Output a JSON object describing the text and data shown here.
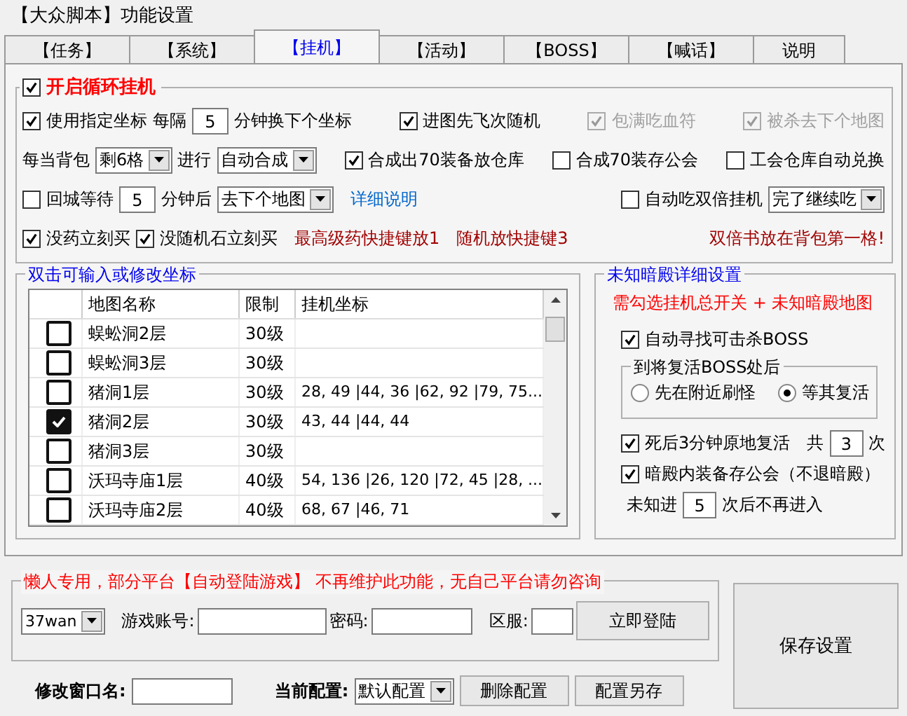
{
  "window": {
    "title": "【大众脚本】功能设置"
  },
  "tabs": [
    {
      "label": "【任务】",
      "selected": false
    },
    {
      "label": "【系统】",
      "selected": false
    },
    {
      "label": "【挂机】",
      "selected": true
    },
    {
      "label": "【活动】",
      "selected": false
    },
    {
      "label": "【BOSS】",
      "selected": false
    },
    {
      "label": "【喊话】",
      "selected": false
    },
    {
      "label": "说明",
      "selected": false
    }
  ],
  "loop_group": {
    "label": "开启循环挂机",
    "checked": true,
    "rows": [
      [
        [
          {
            "kind": "checkbox",
            "label": "使用指定坐标",
            "checked": true,
            "disabled": false
          },
          {
            "kind": "label",
            "text": "每隔"
          },
          {
            "kind": "input",
            "value": "5"
          },
          {
            "kind": "label",
            "text": "分钟换下个坐标"
          }
        ],
        [
          {
            "kind": "checkbox",
            "label": "进图先飞次随机",
            "checked": true,
            "disabled": false
          }
        ],
        [
          {
            "kind": "checkbox",
            "label": "包满吃血符",
            "checked": true,
            "disabled": true
          }
        ],
        [
          {
            "kind": "checkbox",
            "label": "被杀去下个地图",
            "checked": true,
            "disabled": true
          }
        ]
      ],
      [
        [
          {
            "kind": "label",
            "text": "每当背包"
          },
          {
            "kind": "select",
            "value": "剩6格"
          },
          {
            "kind": "label",
            "text": "进行"
          },
          {
            "kind": "select",
            "value": "自动合成"
          }
        ],
        [
          {
            "kind": "checkbox",
            "label": "合成出70装备放仓库",
            "checked": true,
            "disabled": false
          }
        ],
        [
          {
            "kind": "checkbox",
            "label": "合成70装存公会",
            "checked": false,
            "disabled": false
          }
        ],
        [
          {
            "kind": "checkbox",
            "label": "工会仓库自动兑换",
            "checked": false,
            "disabled": false
          }
        ]
      ],
      [
        [
          {
            "kind": "checkbox",
            "label": "回城等待",
            "checked": false,
            "disabled": false
          },
          {
            "kind": "input",
            "value": "5"
          },
          {
            "kind": "label",
            "text": "分钟后"
          },
          {
            "kind": "select",
            "value": "去下个地图"
          },
          {
            "kind": "link",
            "text": "详细说明"
          }
        ],
        [
          {
            "kind": "checkbox",
            "label": "自动吃双倍挂机",
            "checked": false,
            "disabled": false
          },
          {
            "kind": "select",
            "value": "完了继续吃"
          }
        ]
      ],
      [
        [
          {
            "kind": "checkbox",
            "label": "没药立刻买",
            "checked": true,
            "disabled": false
          },
          {
            "kind": "checkbox",
            "label": "没随机石立刻买",
            "checked": true,
            "disabled": false
          },
          {
            "kind": "note",
            "text": "最高级药快捷键放1"
          },
          {
            "kind": "note",
            "text": "随机放快捷键3"
          }
        ],
        [
          {
            "kind": "note",
            "text": "双倍书放在背包第一格!"
          }
        ]
      ]
    ]
  },
  "map_group": {
    "title": "双击可输入或修改坐标",
    "columns": [
      "地图名称",
      "限制",
      "挂机坐标"
    ],
    "rows": [
      {
        "checked": false,
        "name": "蜈蚣洞2层",
        "level": "30级",
        "coords": ""
      },
      {
        "checked": false,
        "name": "蜈蚣洞3层",
        "level": "30级",
        "coords": ""
      },
      {
        "checked": false,
        "name": "猪洞1层",
        "level": "30级",
        "coords": "28, 49 |44, 36 |62, 92 |79, 75..."
      },
      {
        "checked": true,
        "name": "猪洞2层",
        "level": "30级",
        "coords": "43, 44 |44, 44"
      },
      {
        "checked": false,
        "name": "猪洞3层",
        "level": "30级",
        "coords": ""
      },
      {
        "checked": false,
        "name": "沃玛寺庙1层",
        "level": "40级",
        "coords": "54, 136 |26, 120 |72, 45 |28, ..."
      },
      {
        "checked": false,
        "name": "沃玛寺庙2层",
        "level": "40级",
        "coords": "68, 67 |46, 71"
      }
    ]
  },
  "dark_group": {
    "title": "未知暗殿详细设置",
    "warning": "需勾选挂机总开关 + 未知暗殿地图",
    "auto_find": {
      "label": "自动寻找可击杀BOSS",
      "checked": true
    },
    "revive_group": {
      "title": "到将复活BOSS处后",
      "options": [
        {
          "label": "先在附近刷怪",
          "selected": false
        },
        {
          "label": "等其复活",
          "selected": true
        }
      ]
    },
    "revive": {
      "label": "死后3分钟原地复活",
      "checked": true,
      "prefix": "共",
      "value": "3",
      "suffix": "次"
    },
    "store": {
      "label": "暗殿内装备存公会（不退暗殿）",
      "checked": true
    },
    "limit": {
      "prefix": "未知进",
      "value": "5",
      "suffix": "次后不再进入"
    }
  },
  "login_group": {
    "title": "懒人专用，部分平台【自动登陆游戏】 不再维护此功能，无自己平台请勿咨询",
    "platform": "37wan",
    "account_label": "游戏账号:",
    "password_label": "密码:",
    "server_label": "区服:",
    "login_button": "立即登陆"
  },
  "rename_label": "修改窗口名:",
  "config_label": "当前配置:",
  "config_value": "默认配置",
  "buttons": [
    "删除配置",
    "配置另存"
  ],
  "save_button": "保存设置"
}
